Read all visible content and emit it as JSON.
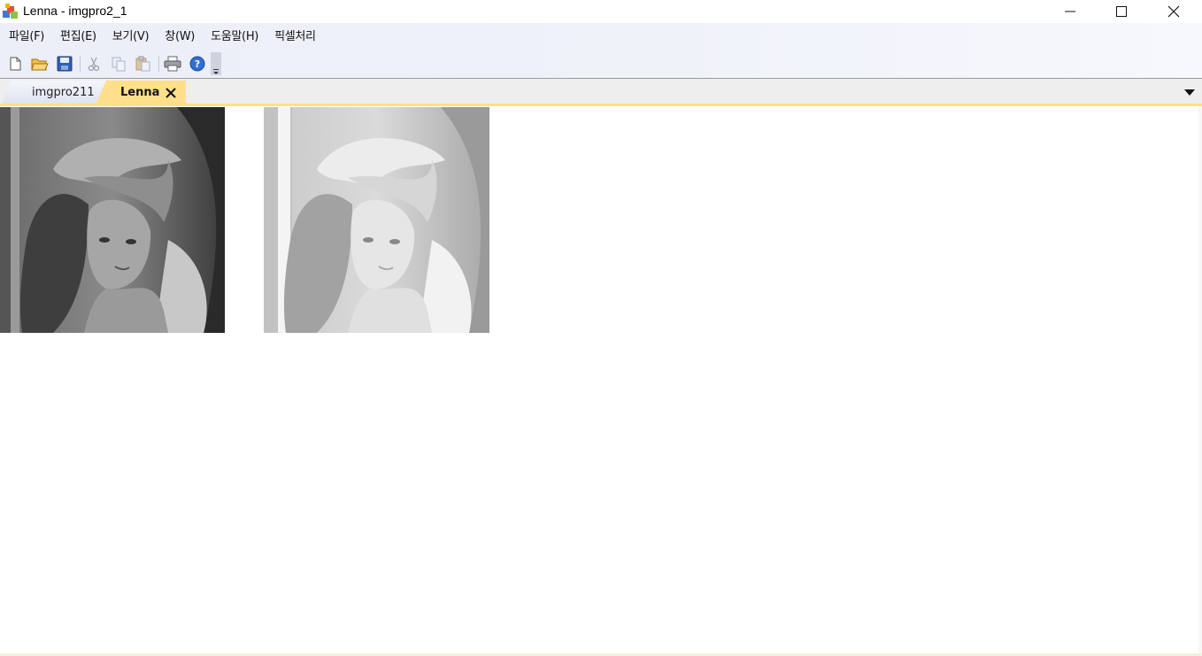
{
  "window": {
    "title": "Lenna - imgpro2_1",
    "controls": [
      "minimize",
      "maximize",
      "close"
    ]
  },
  "menu": {
    "items": [
      {
        "label": "파일(F)"
      },
      {
        "label": "편집(E)"
      },
      {
        "label": "보기(V)"
      },
      {
        "label": "창(W)"
      },
      {
        "label": "도움말(H)"
      },
      {
        "label": "픽셀처리"
      }
    ]
  },
  "toolbar": {
    "buttons": [
      "new-icon",
      "open-icon",
      "save-icon",
      "cut-icon",
      "copy-icon",
      "paste-icon",
      "print-icon",
      "help-icon"
    ]
  },
  "tabs": [
    {
      "label": "imgpro211",
      "active": false
    },
    {
      "label": "Lenna",
      "active": true
    }
  ],
  "images": [
    {
      "description": "original",
      "tone": "normal"
    },
    {
      "description": "processed",
      "tone": "brightened"
    }
  ],
  "colors": {
    "active_tab": "#ffe08a",
    "chrome": "#eceef8"
  }
}
